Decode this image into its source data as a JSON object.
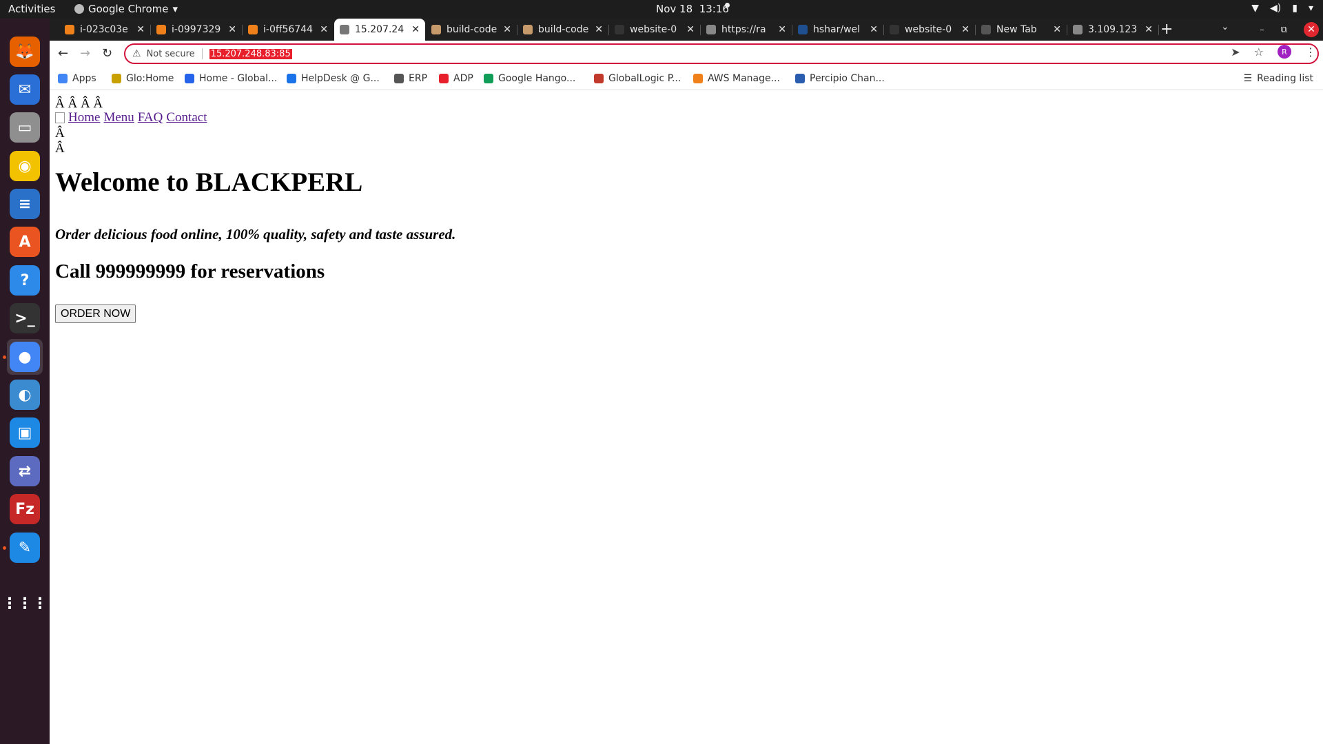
{
  "topbar": {
    "activities": "Activities",
    "app_name": "Google Chrome",
    "date": "Nov 18",
    "time": "13:16"
  },
  "dock": {
    "items": [
      {
        "name": "firefox",
        "color": "#e66000",
        "glyph": "🦊"
      },
      {
        "name": "thunderbird",
        "color": "#2a6fd6",
        "glyph": "✉"
      },
      {
        "name": "files",
        "color": "#8f8f8f",
        "glyph": "▭"
      },
      {
        "name": "rhythmbox",
        "color": "#f2c200",
        "glyph": "◉"
      },
      {
        "name": "libreoffice-writer",
        "color": "#2a72c9",
        "glyph": "≡"
      },
      {
        "name": "ubuntu-software",
        "color": "#e95420",
        "glyph": "A"
      },
      {
        "name": "help",
        "color": "#2d8ae8",
        "glyph": "?"
      },
      {
        "name": "terminal",
        "color": "#333333",
        "glyph": ">_"
      },
      {
        "name": "google-chrome",
        "color": "#4285f4",
        "glyph": "●"
      },
      {
        "name": "network-tool",
        "color": "#3a8bd0",
        "glyph": "◐"
      },
      {
        "name": "virtualbox",
        "color": "#1e88e5",
        "glyph": "▣"
      },
      {
        "name": "remote-desktop",
        "color": "#5c6bc0",
        "glyph": "⇄"
      },
      {
        "name": "filezilla",
        "color": "#c62828",
        "glyph": "Fz"
      },
      {
        "name": "text-editor",
        "color": "#1e88e5",
        "glyph": "✎"
      },
      {
        "name": "show-apps",
        "color": "#2b1a26",
        "glyph": "⋮⋮⋮"
      }
    ]
  },
  "tabs": [
    {
      "title": "i-023c03e",
      "fav_color": "#f0801a"
    },
    {
      "title": "i-0997329",
      "fav_color": "#f0801a"
    },
    {
      "title": "i-0ff56744",
      "fav_color": "#f0801a"
    },
    {
      "title": "15.207.24",
      "fav_color": "#777777",
      "active": true
    },
    {
      "title": "build-code",
      "fav_color": "#c79a6b"
    },
    {
      "title": "build-code",
      "fav_color": "#c79a6b"
    },
    {
      "title": "website-0",
      "fav_color": "#333333"
    },
    {
      "title": "https://ra",
      "fav_color": "#888888"
    },
    {
      "title": "hshar/wel",
      "fav_color": "#1f4f8f"
    },
    {
      "title": "website-0",
      "fav_color": "#333333"
    },
    {
      "title": "New Tab",
      "fav_color": "#555555"
    },
    {
      "title": "3.109.123",
      "fav_color": "#888888"
    }
  ],
  "toolbar": {
    "security_label": "Not secure",
    "url": "15.207.248.83:85",
    "profile_initial": "R"
  },
  "bookmarks": [
    {
      "label": "Apps",
      "color": "#4285f4"
    },
    {
      "label": "Glo:Home",
      "color": "#c8a000"
    },
    {
      "label": "Home - Global...",
      "color": "#2563eb"
    },
    {
      "label": "HelpDesk @ G...",
      "color": "#1a73e8"
    },
    {
      "label": "ERP",
      "color": "#555555"
    },
    {
      "label": "ADP",
      "color": "#e8202b"
    },
    {
      "label": "Google Hango...",
      "color": "#0f9d58"
    },
    {
      "label": "GlobalLogic P...",
      "color": "#c0392b"
    },
    {
      "label": "AWS Manage...",
      "color": "#f0801a"
    },
    {
      "label": "Percipio Chan...",
      "color": "#2a5db0"
    }
  ],
  "reading_list": "Reading list",
  "page": {
    "garble1": "Â Â Â  Â",
    "nav": [
      "Home",
      "Menu",
      "FAQ",
      "Contact"
    ],
    "garble2": "Â",
    "garble3": "Â",
    "heading": "Welcome to BLACKPERL",
    "tagline": "Order delicious food online, 100% quality, safety and taste assured.",
    "reservation": "Call 999999999 for reservations",
    "order_button": "ORDER NOW"
  }
}
